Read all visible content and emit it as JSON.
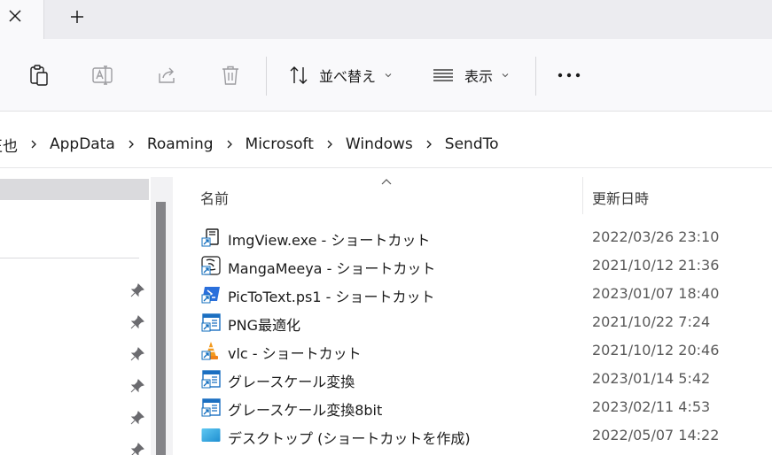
{
  "tabbar": {
    "close_icon": "close-icon",
    "new_tab_icon": "plus-icon"
  },
  "toolbar": {
    "buttons": [
      {
        "name": "paste",
        "icon": "clipboard-icon"
      },
      {
        "name": "rename",
        "icon": "rename-icon"
      },
      {
        "name": "share",
        "icon": "share-icon"
      },
      {
        "name": "delete",
        "icon": "trash-icon"
      }
    ],
    "sort_label": "並べ替え",
    "view_label": "表示",
    "more_icon": "more-icon"
  },
  "address": {
    "crumbs": [
      "正也",
      "AppData",
      "Roaming",
      "Microsoft",
      "Windows",
      "SendTo"
    ]
  },
  "columns": {
    "name": "名前",
    "date": "更新日時"
  },
  "files": [
    {
      "name": "ImgView.exe - ショートカット",
      "date": "2022/03/26 23:10",
      "icon": "app-shortcut-icon"
    },
    {
      "name": "MangaMeeya - ショートカット",
      "date": "2021/10/12 21:36",
      "icon": "mangameeya-icon"
    },
    {
      "name": "PicToText.ps1 - ショートカット",
      "date": "2023/01/07 18:40",
      "icon": "powershell-icon"
    },
    {
      "name": "PNG最適化",
      "date": "2021/10/22 7:24",
      "icon": "shortcut-icon"
    },
    {
      "name": "vlc - ショートカット",
      "date": "2021/10/12 20:46",
      "icon": "vlc-icon"
    },
    {
      "name": "グレースケール変換",
      "date": "2023/01/14 5:42",
      "icon": "shortcut-icon"
    },
    {
      "name": "グレースケール変換8bit",
      "date": "2023/02/11 4:53",
      "icon": "shortcut-icon"
    },
    {
      "name": "デスクトップ (ショートカットを作成)",
      "date": "2022/05/07 14:22",
      "icon": "desktop-icon"
    }
  ],
  "colors": {
    "accent": "#0f6cbd",
    "tabbar_bg": "#ececf0",
    "commandbar_bg": "#f9f9fb",
    "nav_selected": "#dadadd",
    "scroll_thumb": "#848488"
  }
}
